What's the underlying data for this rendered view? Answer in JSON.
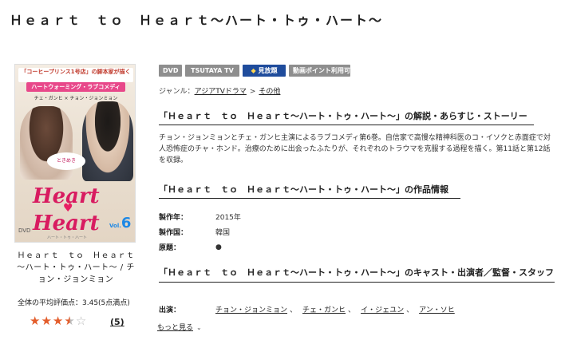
{
  "page": {
    "title": "Ｈｅａｒｔ　ｔｏ　Ｈｅａｒｔ～ハート・トゥ・ハート～"
  },
  "cover": {
    "band": "「コーヒープリンス1号店」の脚本家が描く",
    "band2": "ハートウォーミング・ラブコメディ",
    "names": "チェ・ガンヒ × チョン・ジョンミョン",
    "bubble": "ときめき",
    "logo1": "Heart",
    "logo2": "Heart",
    "vol_prefix": "Vol.",
    "vol_number": "6",
    "dvd": "DVD",
    "sub": "ハート・トゥ・ハート"
  },
  "side": {
    "work_name": "Ｈｅａｒｔ　ｔｏ　Ｈｅａｒｔ～ハート・トゥ・ハート～ / チョン・ジョンミョン",
    "rating_text": "全体の平均評価点：3.45(5点満点)",
    "rating_value": 3.45,
    "rating_max": 5,
    "review_count": "(5)"
  },
  "badges": {
    "dvd": "DVD",
    "tsutaya": "TSUTAYA TV",
    "mihoudai": "見放題",
    "point": "動画ポイント利用可"
  },
  "genre": {
    "label": "ジャンル：",
    "item1": "アジアTVドラマ",
    "separator": ">",
    "item2": "その他"
  },
  "sections": {
    "synopsis_head": "「Ｈｅａｒｔ　ｔｏ　Ｈｅａｒｔ～ハート・トゥ・ハート～」の解説・あらすじ・ストーリー",
    "info_head": "「Ｈｅａｒｔ　ｔｏ　Ｈｅａｒｔ～ハート・トゥ・ハート～」の作品情報",
    "cast_head": "「Ｈｅａｒｔ　ｔｏ　Ｈｅａｒｔ～ハート・トゥ・ハート～」のキャスト・出演者／監督・スタッフ"
  },
  "synopsis": "チョン・ジョンミョンとチェ・ガンヒ主演によるラブコメディ第6巻。自信家で高慢な精神科医のコ・イソクと赤面症で対人恐怖症のチャ・ホンド。治療のために出会ったふたりが、それぞれのトラウマを克服する過程を描く。第11話と第12話を収録。",
  "info": [
    {
      "label": "製作年：",
      "value": "2015年"
    },
    {
      "label": "製作国：",
      "value": "韓国"
    },
    {
      "label": "原題：",
      "value": "●"
    }
  ],
  "cast": {
    "label": "出演：",
    "members": [
      "チョン・ジョンミョン",
      "チェ・ガンヒ",
      "イ・ジェユン",
      "アン・ソヒ"
    ],
    "comma": "、"
  },
  "more": {
    "label": "もっと見る",
    "icon": "chevron-down-icon"
  }
}
